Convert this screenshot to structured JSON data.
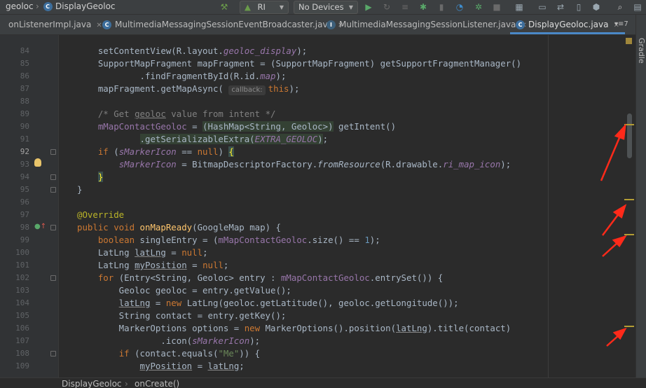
{
  "toolbar": {
    "project": "geoloc",
    "file": "DisplayGeoloc",
    "run_config": "RI",
    "device": "No Devices"
  },
  "tabs": [
    {
      "label": "onListenerImpl.java"
    },
    {
      "label": "MultimediaMessagingSessionEventBroadcaster.java"
    },
    {
      "label": "MultimediaMessagingSessionListener.java"
    },
    {
      "label": "DisplayGeoloc.java"
    }
  ],
  "tab_overflow": "7",
  "side_panel": "Gradle",
  "param_hint": "callback:",
  "line_numbers": [
    "84",
    "85",
    "86",
    "87",
    "88",
    "89",
    "90",
    "91",
    "92",
    "93",
    "94",
    "95",
    "96",
    "97",
    "98",
    "99",
    "100",
    "101",
    "102",
    "103",
    "104",
    "105",
    "106",
    "107",
    "108",
    "109"
  ],
  "breadcrumb": {
    "class_name": "DisplayGeoloc",
    "method_name": "onCreate()"
  },
  "colors": {
    "accent": "#4a88c7",
    "annotation_arrow": "#ff2a1a",
    "marker": "#b39d35"
  }
}
